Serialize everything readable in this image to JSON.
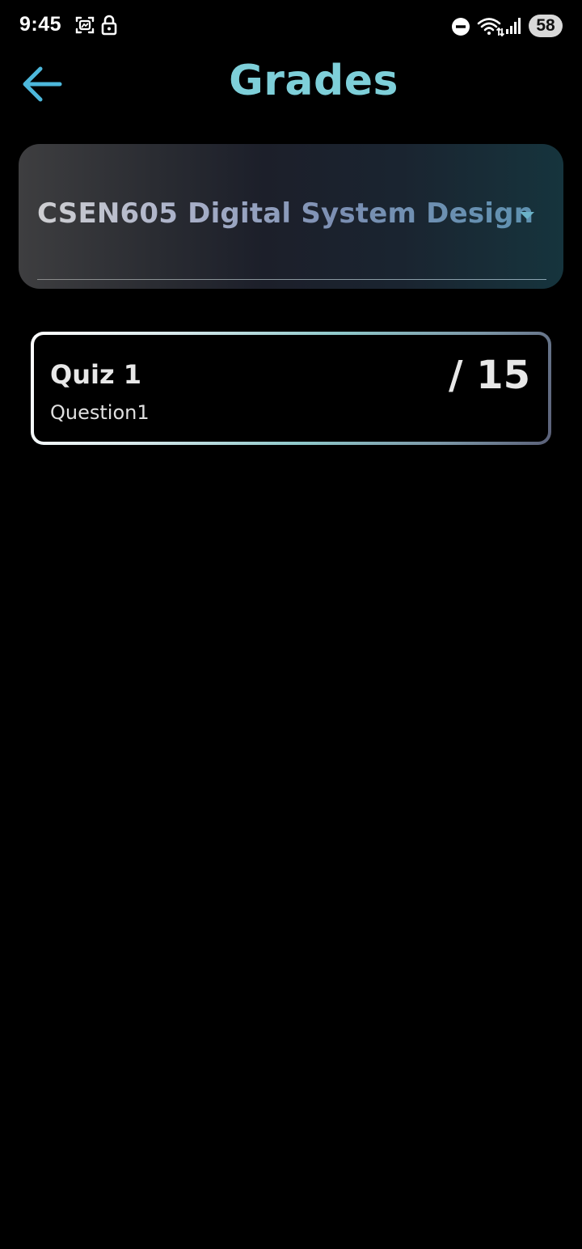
{
  "status_bar": {
    "time": "9:45",
    "battery": "58",
    "icons": [
      "screenshot-icon",
      "lock-icon",
      "do-not-disturb-icon",
      "wifi-icon",
      "signal-icon"
    ]
  },
  "header": {
    "title": "Grades",
    "back_icon": "arrow-left-icon"
  },
  "course_selector": {
    "selected": "CSEN605 Digital System Design",
    "icon": "dropdown-arrow-icon"
  },
  "grades": [
    {
      "title": "Quiz 1",
      "subtitle": "Question1",
      "score": "/ 15"
    }
  ],
  "colors": {
    "accent": "#7ecfd9",
    "back_arrow": "#4db8dc",
    "background": "#000000"
  }
}
